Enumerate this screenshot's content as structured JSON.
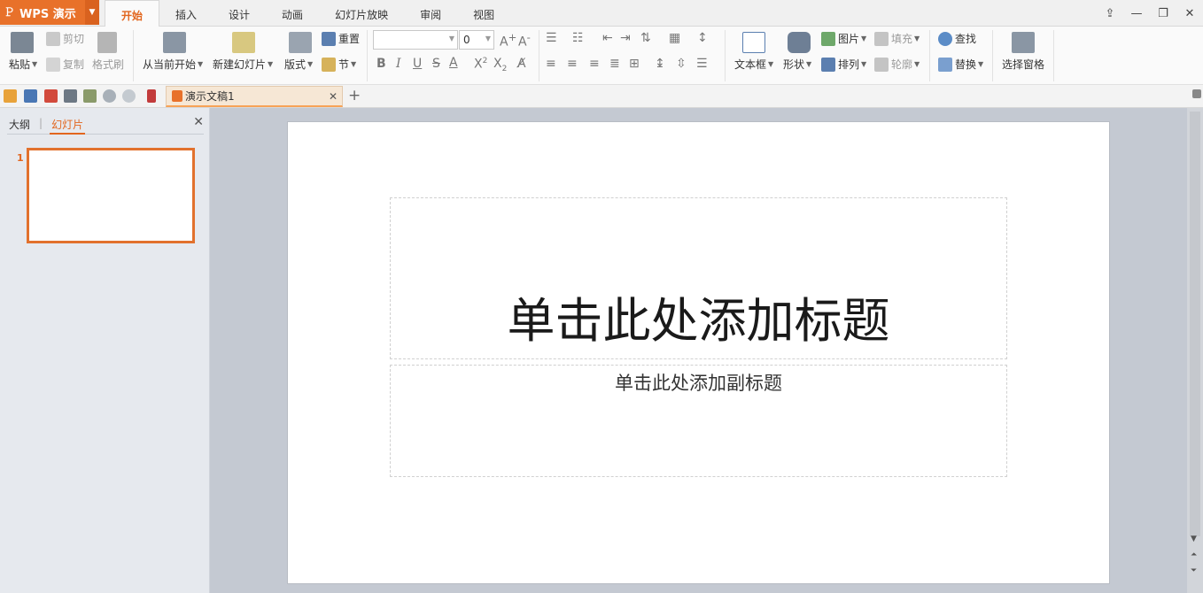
{
  "app": {
    "title": "WPS 演示"
  },
  "tabs": [
    "开始",
    "插入",
    "设计",
    "动画",
    "幻灯片放映",
    "审阅",
    "视图"
  ],
  "active_tab": "开始",
  "ribbon": {
    "paste": "粘贴",
    "cut": "剪切",
    "copy": "复制",
    "format_painter": "格式刷",
    "from_current": "从当前开始",
    "new_slide": "新建幻灯片",
    "layout": "版式",
    "reset": "重置",
    "section": "节",
    "font_size": "0",
    "text_box": "文本框",
    "shapes": "形状",
    "picture": "图片",
    "fill": "填充",
    "arrange": "排列",
    "outline": "轮廓",
    "find": "查找",
    "replace": "替换",
    "selection_pane": "选择窗格"
  },
  "document_tab": {
    "name": "演示文稿1"
  },
  "left_panel": {
    "tab_outline": "大纲",
    "tab_slides": "幻灯片",
    "slide_number": "1"
  },
  "slide": {
    "title_placeholder": "单击此处添加标题",
    "subtitle_placeholder": "单击此处添加副标题"
  },
  "colors": {
    "accent": "#e2661e",
    "app_button": "#e8712a"
  }
}
